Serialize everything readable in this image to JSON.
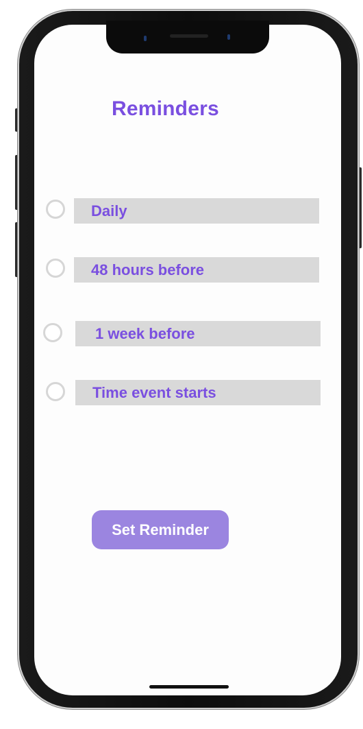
{
  "screen": {
    "title": "Reminders"
  },
  "options": [
    {
      "label": "Daily",
      "selected": false
    },
    {
      "label": "48 hours before",
      "selected": false
    },
    {
      "label": "1 week before",
      "selected": false
    },
    {
      "label": "Time event starts",
      "selected": false
    }
  ],
  "actions": {
    "set_reminder_label": "Set Reminder"
  },
  "colors": {
    "accent": "#7a4fe0",
    "button": "#9b85e0",
    "option_bg": "#d9d9d9",
    "radio_border": "#d6d6d6"
  }
}
